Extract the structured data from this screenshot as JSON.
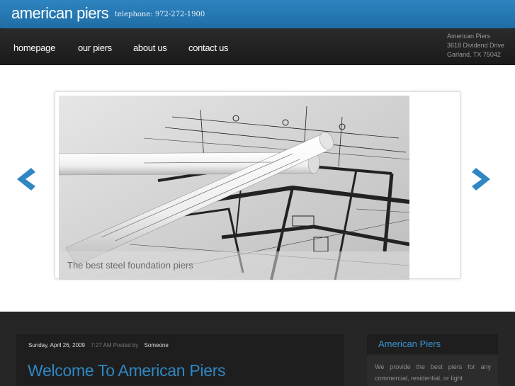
{
  "header": {
    "brand": "american piers",
    "phone": "telephone: 972-272-1900"
  },
  "nav": {
    "items": [
      {
        "label": "homepage"
      },
      {
        "label": "our piers"
      },
      {
        "label": "about us"
      },
      {
        "label": "contact us"
      }
    ]
  },
  "address": {
    "line1": "American Piers",
    "line2": "3618 Dividend Drive",
    "line3": "Garland, TX 75042"
  },
  "slider": {
    "caption": "The best steel foundation piers"
  },
  "post": {
    "date": "Sunday, April 26, 2009",
    "time": "7:27 AM Posted by",
    "author": "Someone",
    "title": "Welcome To American Piers"
  },
  "sidebar": {
    "title": "American Piers",
    "text": "We provide the best piers for any commercial, residential, or light"
  },
  "colors": {
    "accent": "#2f87c2",
    "topbar": "#2378b3",
    "navbar": "#222222"
  }
}
